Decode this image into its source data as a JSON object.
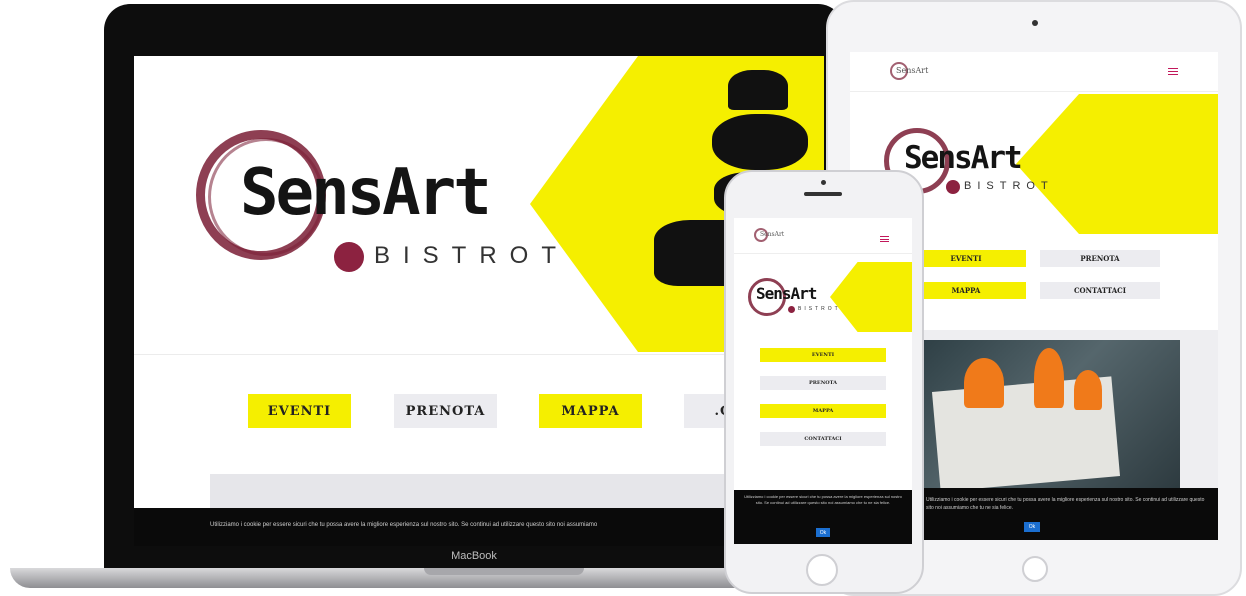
{
  "brand": {
    "name": "SensArt",
    "sub": "BISTROT"
  },
  "laptop": {
    "label": "MacBook",
    "menu": [
      "EVENTI",
      "PRENOTA",
      "MAPPA",
      ".CON"
    ],
    "cookie": "Utilizziamo i cookie per essere sicuri che tu possa avere la migliore esperienza sul nostro sito. Se continui ad utilizzare questo sito noi assumiamo"
  },
  "tablet": {
    "menu": [
      "EVENTI",
      "PRENOTA",
      "MAPPA",
      "CONTATTACI"
    ],
    "cookie": "Utilizziamo i cookie per essere sicuri che tu possa avere la migliore esperienza sul nostro sito. Se continui ad utilizzare questo sito noi assumiamo che tu ne sia felice.",
    "ok": "Ok"
  },
  "phone": {
    "menu": [
      "EVENTI",
      "PRENOTA",
      "MAPPA",
      "CONTATTACI"
    ],
    "cookie": "Utilizziamo i cookie per essere sicuri che tu possa avere la migliore esperienza sul nostro sito. Se continui ad utilizzare questo sito noi assumiamo che tu ne sia felice.",
    "ok": "Ok"
  },
  "colors": {
    "accent": "#f5ef00",
    "wine": "#7a1d35",
    "menu_gray": "#ececf0"
  }
}
